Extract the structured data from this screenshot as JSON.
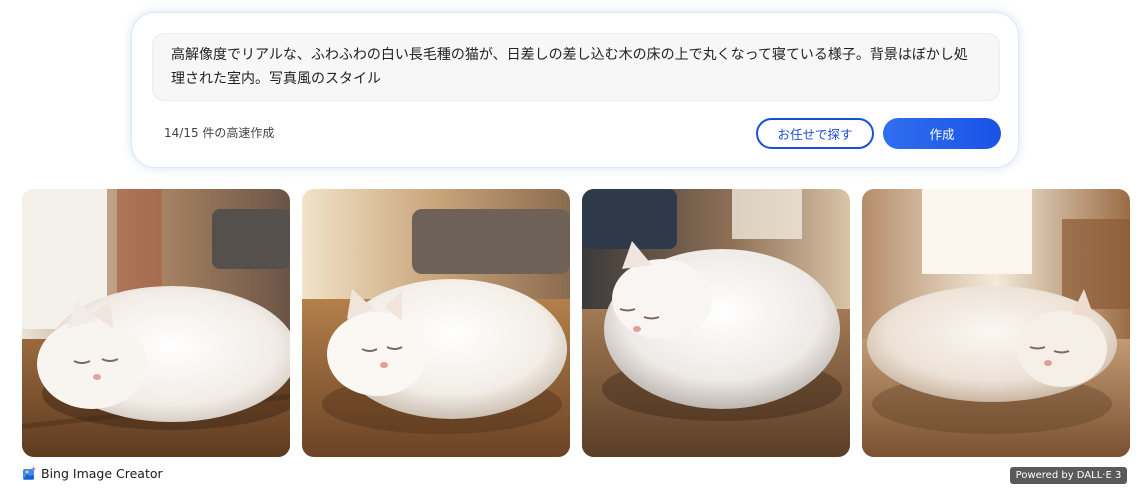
{
  "prompt": {
    "text": "高解像度でリアルな、ふわふわの白い長毛種の猫が、日差しの差し込む木の床の上で丸くなって寝ている様子。背景はぼかし処理された室内。写真風のスタイル",
    "boost_count": "14/15 件の高速作成"
  },
  "buttons": {
    "surprise_label": "お任せで探す",
    "create_label": "作成"
  },
  "images": [
    {
      "icon": "sleeping-white-cat-image"
    },
    {
      "icon": "sleeping-white-cat-image"
    },
    {
      "icon": "sleeping-white-cat-image"
    },
    {
      "icon": "sleeping-white-cat-image"
    }
  ],
  "footer": {
    "brand": "Bing Image Creator",
    "brand_icon": "bing-image-creator-icon",
    "powered_by": "Powered by DALL·E 3"
  },
  "colors": {
    "accent": "#1b4fd6",
    "create_button": "#2160ea",
    "badge": "#5a5a5a"
  }
}
